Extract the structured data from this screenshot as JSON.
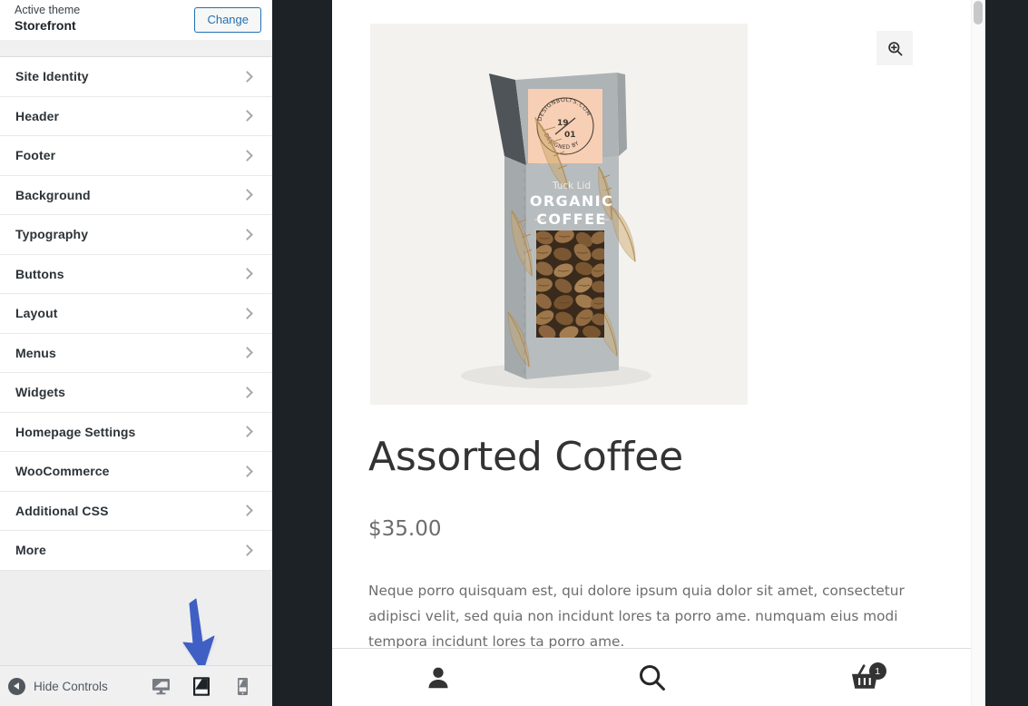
{
  "sidebar": {
    "theme": {
      "active_label": "Active theme",
      "name": "Storefront",
      "change_button": "Change"
    },
    "menu_items": [
      {
        "label": "Site Identity",
        "icon": "chevron-right-icon"
      },
      {
        "label": "Header",
        "icon": "chevron-right-icon"
      },
      {
        "label": "Footer",
        "icon": "chevron-right-icon"
      },
      {
        "label": "Background",
        "icon": "chevron-right-icon"
      },
      {
        "label": "Typography",
        "icon": "chevron-right-icon"
      },
      {
        "label": "Buttons",
        "icon": "chevron-right-icon"
      },
      {
        "label": "Layout",
        "icon": "chevron-right-icon"
      },
      {
        "label": "Menus",
        "icon": "chevron-right-icon"
      },
      {
        "label": "Widgets",
        "icon": "chevron-right-icon"
      },
      {
        "label": "Homepage Settings",
        "icon": "chevron-right-icon"
      },
      {
        "label": "WooCommerce",
        "icon": "chevron-right-icon"
      },
      {
        "label": "Additional CSS",
        "icon": "chevron-right-icon"
      },
      {
        "label": "More",
        "icon": "chevron-right-icon"
      }
    ]
  },
  "footer": {
    "hide_controls_label": "Hide Controls",
    "collapse_icon": "collapse-left-icon",
    "devices": [
      {
        "name": "desktop",
        "icon": "desktop-icon",
        "selected": false
      },
      {
        "name": "tablet",
        "icon": "tablet-icon",
        "selected": true
      },
      {
        "name": "mobile",
        "icon": "mobile-icon",
        "selected": false
      }
    ]
  },
  "annotation": {
    "type": "arrow-down",
    "color": "#3f5fc4",
    "points_to": "tablet-device-button"
  },
  "preview": {
    "zoom_icon": "magnifier-plus-icon",
    "product": {
      "image_alt": "Organic coffee tuck lid box with coffee beans window",
      "image_labels": {
        "seal_top": "DESIGNBOLTS.COM",
        "seal_bottom": "DESIGNED BY",
        "seal_numbers": "19 / 01",
        "small_line": "Tuck Lid",
        "line1": "ORGANIC",
        "line2": "COFFEE"
      },
      "title": "Assorted Coffee",
      "price": "$35.00",
      "description": "Neque porro quisquam est, qui dolore ipsum quia dolor sit amet, consectetur adipisci velit, sed quia non incidunt lores ta porro ame. numquam eius modi tempora incidunt lores ta porro ame."
    },
    "bottom_nav": [
      {
        "name": "account",
        "icon": "person-icon",
        "badge": null
      },
      {
        "name": "search",
        "icon": "search-icon",
        "badge": null
      },
      {
        "name": "cart",
        "icon": "basket-icon",
        "badge": "1"
      }
    ]
  },
  "colors": {
    "accent_link": "#2271b1",
    "dark_chrome": "#1d2227",
    "annotation_blue": "#3f5fc4",
    "sidebar_bg": "#eeeeee",
    "product_image_bg": "#f3f2ef"
  }
}
